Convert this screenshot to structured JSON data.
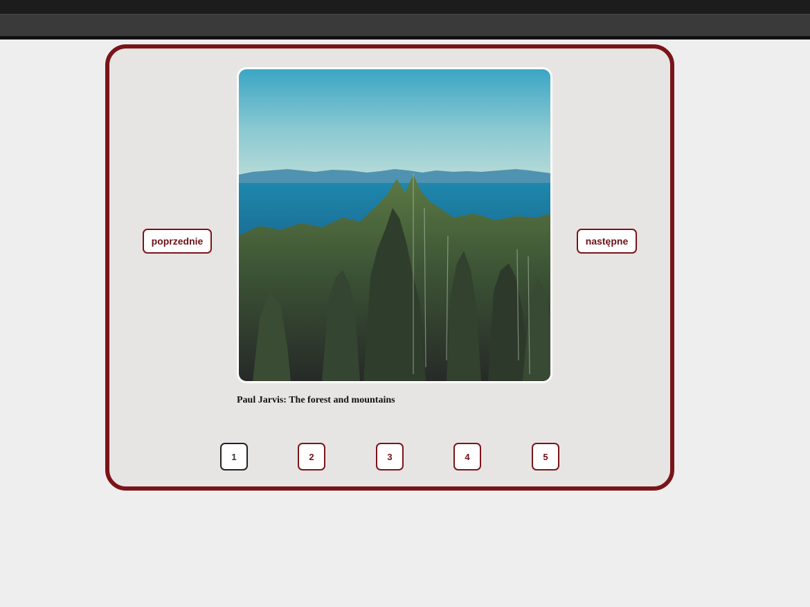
{
  "gallery": {
    "prev_label": "poprzednie",
    "next_label": "następne",
    "caption": "Paul Jarvis: The forest and mountains",
    "pages": [
      "1",
      "2",
      "3",
      "4",
      "5"
    ],
    "active_page": "1"
  },
  "colors": {
    "accent": "#7a1418",
    "panel_bg": "#e7e5e4",
    "page_bg": "#eeeeee"
  }
}
